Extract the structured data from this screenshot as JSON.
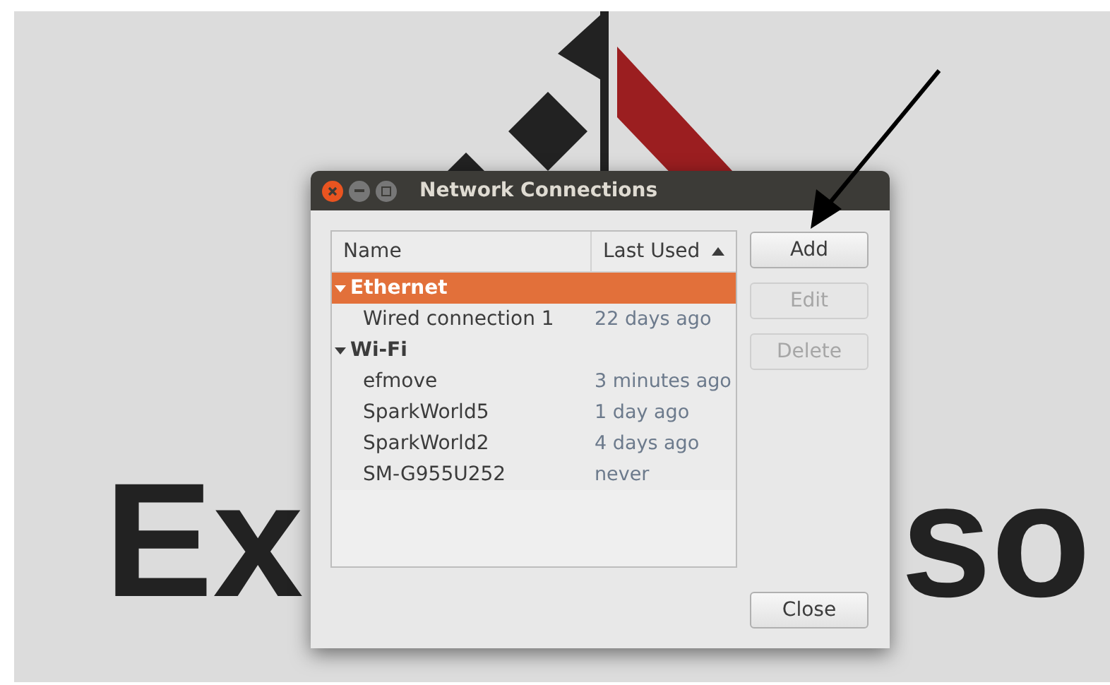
{
  "wallpaper": {
    "text_left": "Ex",
    "text_right": "so"
  },
  "window": {
    "title": "Network Connections"
  },
  "table": {
    "columns": [
      {
        "label": "Name",
        "sorted": false
      },
      {
        "label": "Last Used",
        "sorted": true
      }
    ],
    "groups": [
      {
        "name": "Ethernet",
        "selected": true,
        "expanded": true,
        "children": [
          {
            "name": "Wired connection 1",
            "last_used": "22 days ago"
          }
        ]
      },
      {
        "name": "Wi-Fi",
        "selected": false,
        "expanded": true,
        "children": [
          {
            "name": "efmove",
            "last_used": "3 minutes ago"
          },
          {
            "name": "SparkWorld5",
            "last_used": "1 day ago"
          },
          {
            "name": "SparkWorld2",
            "last_used": "4 days ago"
          },
          {
            "name": "SM-G955U252",
            "last_used": "never"
          }
        ]
      }
    ]
  },
  "buttons": [
    {
      "label": "Add",
      "disabled": false
    },
    {
      "label": "Edit",
      "disabled": true
    },
    {
      "label": "Delete",
      "disabled": true
    }
  ],
  "close_button": {
    "label": "Close"
  }
}
